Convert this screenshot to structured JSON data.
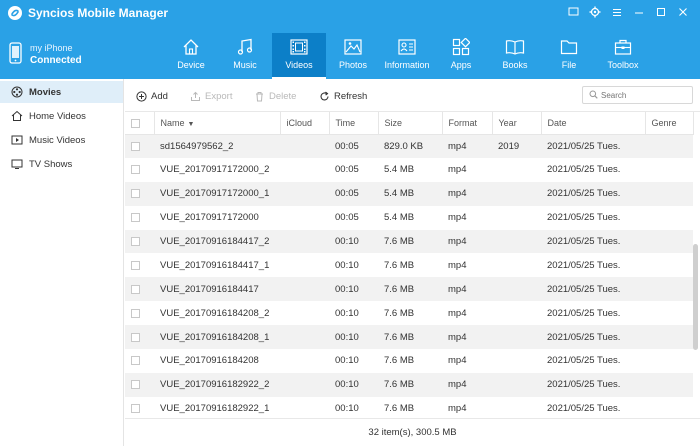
{
  "app": {
    "title": "Syncios Mobile Manager"
  },
  "device": {
    "name": "my iPhone",
    "status": "Connected"
  },
  "nav": [
    {
      "label": "Device",
      "icon": "home-icon",
      "active": false
    },
    {
      "label": "Music",
      "icon": "music-note-icon",
      "active": false
    },
    {
      "label": "Videos",
      "icon": "video-film-icon",
      "active": true
    },
    {
      "label": "Photos",
      "icon": "photo-icon",
      "active": false
    },
    {
      "label": "Information",
      "icon": "contact-card-icon",
      "active": false
    },
    {
      "label": "Apps",
      "icon": "apps-grid-icon",
      "active": false
    },
    {
      "label": "Books",
      "icon": "book-icon",
      "active": false
    },
    {
      "label": "File",
      "icon": "folder-icon",
      "active": false
    },
    {
      "label": "Toolbox",
      "icon": "toolbox-icon",
      "active": false
    }
  ],
  "sidebar": {
    "items": [
      {
        "label": "Movies",
        "icon": "movie-reel-icon",
        "active": true
      },
      {
        "label": "Home Videos",
        "icon": "home-icon",
        "active": false
      },
      {
        "label": "Music Videos",
        "icon": "music-video-icon",
        "active": false
      },
      {
        "label": "TV Shows",
        "icon": "tv-icon",
        "active": false
      }
    ]
  },
  "toolbar": {
    "add_label": "Add",
    "export_label": "Export",
    "delete_label": "Delete",
    "refresh_label": "Refresh",
    "search_placeholder": "Search"
  },
  "table": {
    "columns": [
      "",
      "Name",
      "iCloud",
      "Time",
      "Size",
      "Format",
      "Year",
      "Date",
      "Genre"
    ],
    "rows": [
      [
        "sd1564979562_2",
        "",
        "00:05",
        "829.0 KB",
        "mp4",
        "2019",
        "2021/05/25 Tues.",
        ""
      ],
      [
        "VUE_20170917172000_2",
        "",
        "00:05",
        "5.4 MB",
        "mp4",
        "",
        "2021/05/25 Tues.",
        ""
      ],
      [
        "VUE_20170917172000_1",
        "",
        "00:05",
        "5.4 MB",
        "mp4",
        "",
        "2021/05/25 Tues.",
        ""
      ],
      [
        "VUE_20170917172000",
        "",
        "00:05",
        "5.4 MB",
        "mp4",
        "",
        "2021/05/25 Tues.",
        ""
      ],
      [
        "VUE_20170916184417_2",
        "",
        "00:10",
        "7.6 MB",
        "mp4",
        "",
        "2021/05/25 Tues.",
        ""
      ],
      [
        "VUE_20170916184417_1",
        "",
        "00:10",
        "7.6 MB",
        "mp4",
        "",
        "2021/05/25 Tues.",
        ""
      ],
      [
        "VUE_20170916184417",
        "",
        "00:10",
        "7.6 MB",
        "mp4",
        "",
        "2021/05/25 Tues.",
        ""
      ],
      [
        "VUE_20170916184208_2",
        "",
        "00:10",
        "7.6 MB",
        "mp4",
        "",
        "2021/05/25 Tues.",
        ""
      ],
      [
        "VUE_20170916184208_1",
        "",
        "00:10",
        "7.6 MB",
        "mp4",
        "",
        "2021/05/25 Tues.",
        ""
      ],
      [
        "VUE_20170916184208",
        "",
        "00:10",
        "7.6 MB",
        "mp4",
        "",
        "2021/05/25 Tues.",
        ""
      ],
      [
        "VUE_20170916182922_2",
        "",
        "00:10",
        "7.6 MB",
        "mp4",
        "",
        "2021/05/25 Tues.",
        ""
      ],
      [
        "VUE_20170916182922_1",
        "",
        "00:10",
        "7.6 MB",
        "mp4",
        "",
        "2021/05/25 Tues.",
        ""
      ]
    ]
  },
  "status": {
    "text": "32 item(s), 300.5 MB"
  },
  "colors": {
    "accent": "#2aa1e6",
    "active_tab": "#0c7fc8",
    "sidebar_active": "#dfeef9"
  }
}
